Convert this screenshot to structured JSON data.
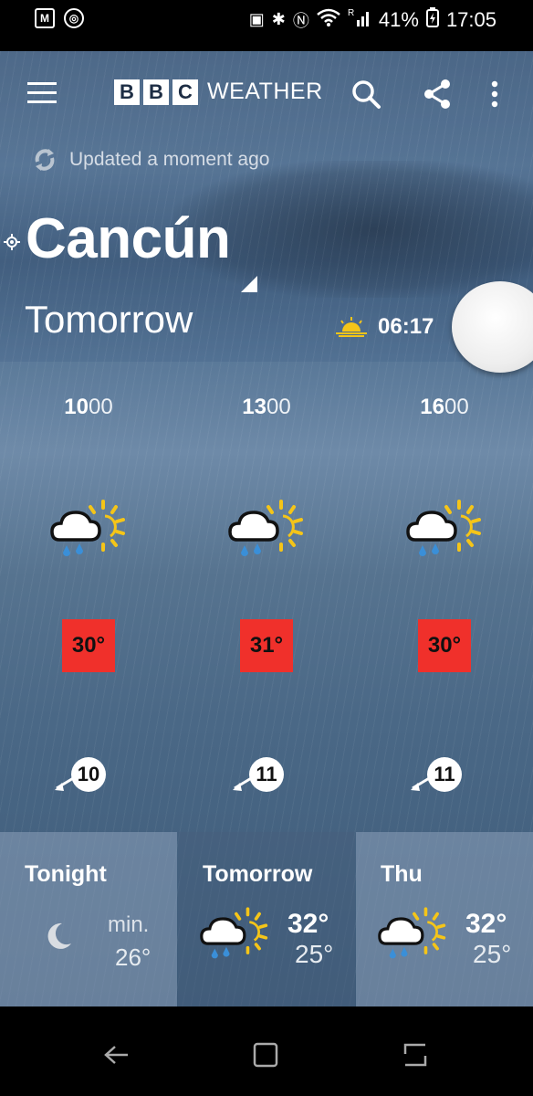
{
  "status_bar": {
    "battery": "41%",
    "time": "17:05",
    "network": "R"
  },
  "header": {
    "logo_letters": [
      "B",
      "B",
      "C"
    ],
    "logo_word": "WEATHER"
  },
  "updated_text": "Updated a moment ago",
  "location": {
    "city": "Cancún",
    "day": "Tomorrow",
    "sunrise_time": "06:17"
  },
  "hourly": [
    {
      "hour": "10",
      "minutes": "00",
      "temp": "30°",
      "wind": "10",
      "icon": "rain-sun-icon"
    },
    {
      "hour": "13",
      "minutes": "00",
      "temp": "31°",
      "wind": "11",
      "icon": "rain-sun-icon"
    },
    {
      "hour": "16",
      "minutes": "00",
      "temp": "30°",
      "wind": "11",
      "icon": "rain-sun-icon"
    }
  ],
  "daily": [
    {
      "name": "Tonight",
      "min_label": "min.",
      "low": "26°",
      "icon": "moon-icon"
    },
    {
      "name": "Tomorrow",
      "high": "32°",
      "low": "25°",
      "icon": "rain-sun-icon"
    },
    {
      "name": "Thu",
      "high": "32°",
      "low": "25°",
      "icon": "rain-sun-icon"
    }
  ],
  "colors": {
    "temp_badge": "#f0302b",
    "sun": "#f5c518",
    "rain": "#3a8fd8"
  }
}
